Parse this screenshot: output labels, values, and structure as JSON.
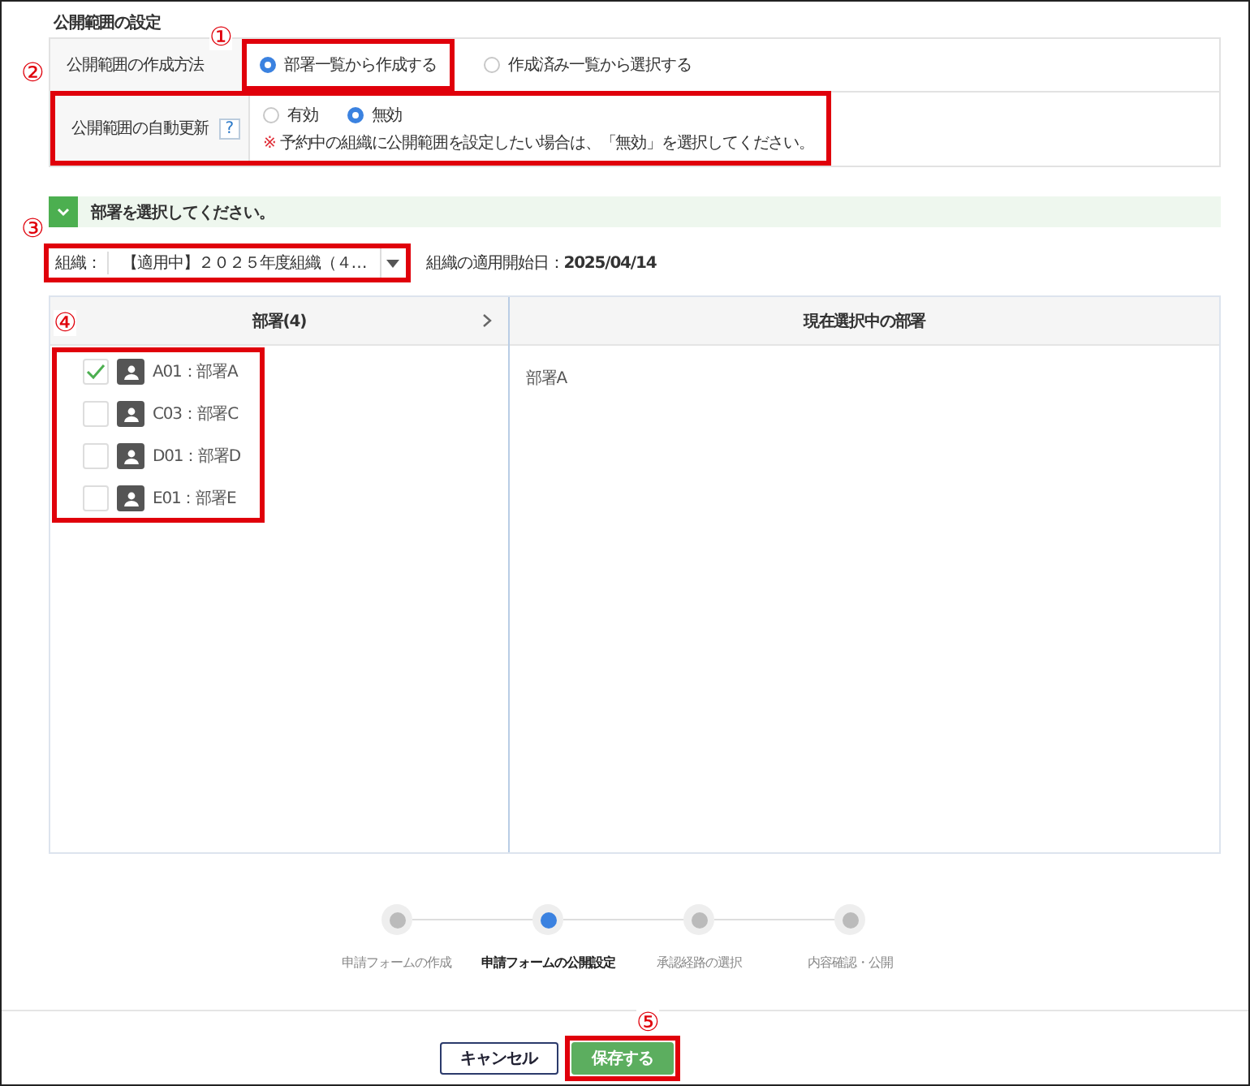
{
  "title": "公開範囲の設定",
  "settings": [
    {
      "label": "公開範囲の作成方法",
      "kind": "radio",
      "options": [
        {
          "label": "部署一覧から作成する",
          "selected": true
        },
        {
          "label": "作成済み一覧から選択する",
          "selected": false
        }
      ]
    },
    {
      "label": "公開範囲の自動更新",
      "help": "?",
      "kind": "radio_note",
      "options": [
        {
          "label": "有効",
          "selected": false
        },
        {
          "label": "無効",
          "selected": true
        }
      ],
      "note_mark": "※",
      "note": "予約中の組織に公開範囲を設定したい場合は、「無効」を選択してください。"
    }
  ],
  "banner": {
    "text": "部署を選択してください。"
  },
  "organization": {
    "label": "組織：",
    "value": "【適用中】２０２５年度組織（４…",
    "start_label": "組織の適用開始日：",
    "start_date": "2025/04/14"
  },
  "departments": {
    "header": "部署(4)",
    "items": [
      {
        "label": "A01：部署A",
        "checked": true
      },
      {
        "label": "C03：部署C",
        "checked": false
      },
      {
        "label": "D01：部署D",
        "checked": false
      },
      {
        "label": "E01：部署E",
        "checked": false
      }
    ]
  },
  "selected_panel": {
    "header": "現在選択中の部署",
    "items": [
      "部署A"
    ]
  },
  "steps": [
    {
      "label": "申請フォームの作成",
      "selected": false
    },
    {
      "label": "申請フォームの公開設定",
      "selected": true
    },
    {
      "label": "承認経路の選択",
      "selected": false
    },
    {
      "label": "内容確認・公開",
      "selected": false
    }
  ],
  "buttons": [
    {
      "label": "キャンセル",
      "kind": "secondary"
    },
    {
      "label": "保存する",
      "kind": "primary"
    }
  ],
  "callouts": [
    "①",
    "②",
    "③",
    "④",
    "⑤"
  ]
}
